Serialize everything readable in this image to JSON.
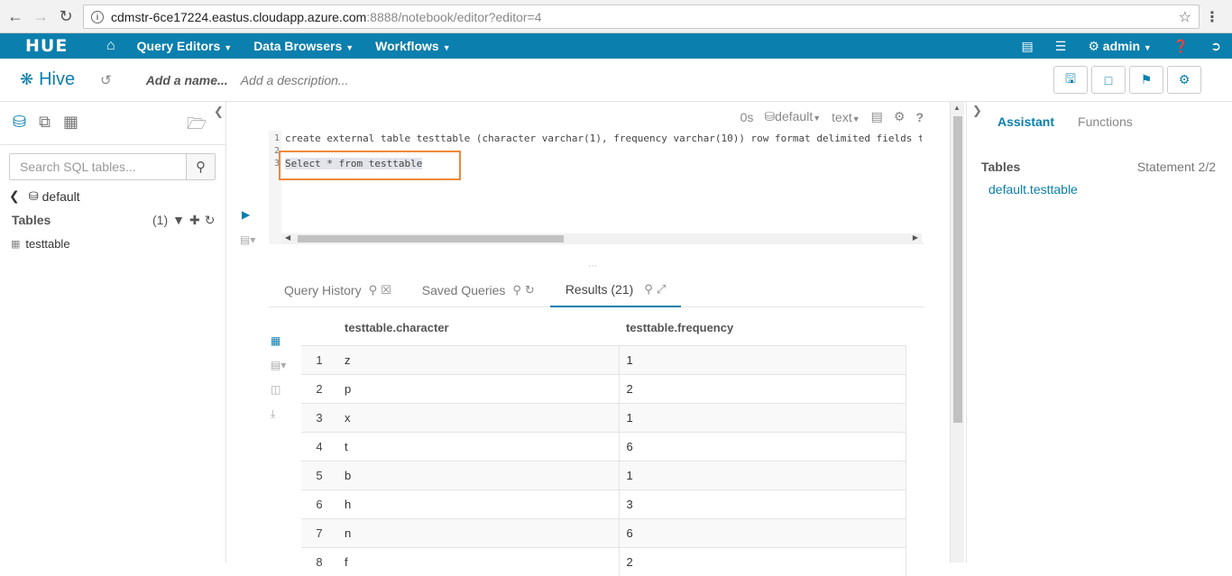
{
  "browser": {
    "url_host": "cdmstr-6ce17224.eastus.cloudapp.azure.com",
    "url_path": ":8888/notebook/editor?editor=4"
  },
  "topnav": {
    "logo": "HUE",
    "items": [
      "Query Editors",
      "Data Browsers",
      "Workflows"
    ],
    "user": "admin"
  },
  "editor_header": {
    "app": "Hive",
    "name_placeholder": "Add a name...",
    "desc_placeholder": "Add a description..."
  },
  "left": {
    "search_placeholder": "Search SQL tables...",
    "database": "default",
    "tables_label": "Tables",
    "tables_count": "(1)",
    "tables": [
      "testtable"
    ]
  },
  "toolbar": {
    "time": "0s",
    "database": "default",
    "format": "text"
  },
  "editor": {
    "line_numbers": [
      "1",
      "2",
      "3"
    ],
    "line1": "create external table testtable (character varchar(1), frequency  varchar(10)) row format delimited fields terminated by ','",
    "line3": "Select * from testtable"
  },
  "tabs": {
    "history": "Query History",
    "saved": "Saved Queries",
    "results": "Results (21)"
  },
  "results": {
    "columns": [
      "testtable.character",
      "testtable.frequency"
    ],
    "rows": [
      [
        "1",
        "z",
        "1"
      ],
      [
        "2",
        "p",
        "2"
      ],
      [
        "3",
        "x",
        "1"
      ],
      [
        "4",
        "t",
        "6"
      ],
      [
        "5",
        "b",
        "1"
      ],
      [
        "6",
        "h",
        "3"
      ],
      [
        "7",
        "n",
        "6"
      ],
      [
        "8",
        "f",
        "2"
      ]
    ]
  },
  "assistant": {
    "tab_assistant": "Assistant",
    "tab_functions": "Functions",
    "tables_label": "Tables",
    "statement": "Statement 2/2",
    "table_link": "default.testtable"
  },
  "colors": {
    "accent": "#0b7fad",
    "highlight_box": "#f0883a"
  }
}
